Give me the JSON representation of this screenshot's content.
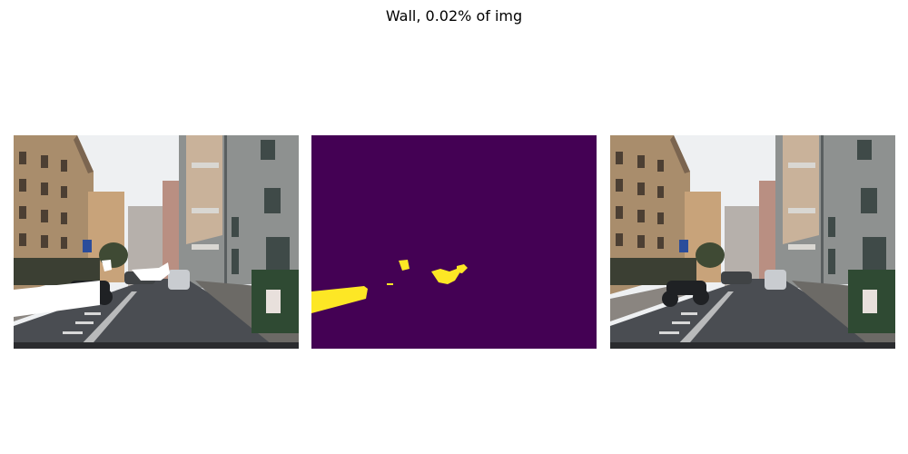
{
  "figure": {
    "title": "Wall, 0.02% of img"
  },
  "panels": [
    {
      "name": "original-street-image-with-white-overlay"
    },
    {
      "name": "segmentation-mask"
    },
    {
      "name": "original-street-image"
    }
  ],
  "colors": {
    "mask_background": "#440154",
    "mask_foreground": "#fde725",
    "overlay": "#ffffff",
    "sky": "#eef0f2",
    "building_left": "#a98d6c",
    "building_right": "#8e9190",
    "road": "#4a4d52",
    "sidewalk": "#8a8580"
  }
}
